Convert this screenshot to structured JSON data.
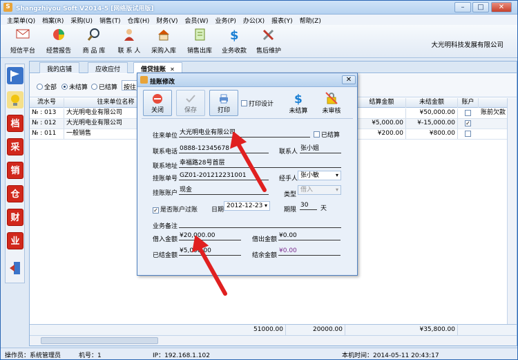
{
  "window": {
    "title": "Shangzhiyou Soft V2014-5 [网络版试用版]",
    "min": "–",
    "max": "□",
    "close": "✕"
  },
  "menu": [
    "主菜单(Q)",
    "档案(R)",
    "采购(U)",
    "销售(T)",
    "仓库(H)",
    "财务(V)",
    "会员(W)",
    "业务(P)",
    "办公(X)",
    "报表(Y)",
    "帮助(Z)"
  ],
  "toolbar": [
    {
      "label": "短信平台",
      "icon": "mail-icon"
    },
    {
      "label": "经营报告",
      "icon": "pie-chart-icon"
    },
    {
      "label": "商 品 库",
      "icon": "magnifier-icon"
    },
    {
      "label": "联 系 人",
      "icon": "person-icon"
    },
    {
      "label": "采购入库",
      "icon": "house-icon"
    },
    {
      "label": "销售出库",
      "icon": "document-icon"
    },
    {
      "label": "业务收款",
      "icon": "dollar-icon"
    },
    {
      "label": "售后维护",
      "icon": "tools-icon"
    }
  ],
  "company": "大光明科技发展有限公司",
  "sidebar": [
    {
      "icon": "flag-icon",
      "text": ""
    },
    {
      "icon": "lightbulb-icon",
      "text": ""
    },
    {
      "icon": "archive-icon",
      "text": "档"
    },
    {
      "icon": "purchase-icon",
      "text": "采"
    },
    {
      "icon": "sales-icon",
      "text": "销"
    },
    {
      "icon": "warehouse-icon",
      "text": "仓"
    },
    {
      "icon": "finance-icon",
      "text": "财"
    },
    {
      "icon": "business-icon",
      "text": "业"
    },
    {
      "icon": "exit-icon",
      "text": ""
    }
  ],
  "tabs": [
    {
      "label": "我的店铺"
    },
    {
      "label": "应收应付"
    },
    {
      "label": "借贷挂账",
      "close": "✕"
    }
  ],
  "filter": {
    "all": "全部",
    "unsettled": "未结算",
    "settled": "已结算",
    "by": "按往"
  },
  "grid": {
    "headers": [
      "流水号",
      "往来单位名称",
      "结算金额",
      "未结金额",
      "账户"
    ],
    "rows": [
      {
        "no": "№ : 013",
        "name": "大光明电业有限公司",
        "settled": "",
        "unsettled": "¥50,000.00",
        "checked": false,
        "note": "账前欠款"
      },
      {
        "no": "№ : 012",
        "name": "大光明电业有限公司",
        "settled": "¥5,000.00",
        "unsettled": "¥-15,000.00",
        "checked": true,
        "note": ""
      },
      {
        "no": "№ : 011",
        "name": "一般销售",
        "settled": "¥200.00",
        "unsettled": "¥800.00",
        "checked": false,
        "note": ""
      }
    ],
    "totals": {
      "a": "51000.00",
      "b": "20000.00",
      "c": "¥35,800.00"
    }
  },
  "dialog": {
    "title": "挂账修改",
    "buttons": {
      "close": "关闭",
      "save": "保存",
      "print": "打印",
      "print_design": "打印设计",
      "unsettled": "未结算",
      "unaudited": "未审核"
    },
    "fields": {
      "unit_label": "往来单位",
      "unit_value": "大光明电业有限公司",
      "settled_check": "已结算",
      "phone_label": "联系电话",
      "phone_value": "0888-12345678",
      "contact_label": "联系人",
      "contact_value": "张小姐",
      "address_label": "联系地址",
      "address_value": "幸福路28号首层",
      "bill_label": "挂账单号",
      "bill_value": "GZ01-201212231001",
      "handler_label": "经手人",
      "handler_value": "张小敏",
      "account_label": "挂账账户",
      "account_value": "现金",
      "type_label": "类型",
      "type_value": "借入",
      "overdue_label": "是否账户过账",
      "date_label": "日期",
      "date_value": "2012-12-23",
      "period_label": "期限",
      "period_value": "30",
      "period_unit": "天",
      "remark_label": "业务备注",
      "borrow_in_label": "借入金额",
      "borrow_in_value": "¥20,000.00",
      "borrow_out_label": "借出金额",
      "borrow_out_value": "¥0.00",
      "settled_label": "已结金额",
      "settled_value": "¥5,000.00",
      "balance_label": "结余金额",
      "balance_value": "¥0.00"
    }
  },
  "status": {
    "operator": "操作员：系统管理员",
    "machine": "机号：1",
    "ip": "IP：192.168.1.102",
    "time": "本机时间：2014-05-11 20:43:17"
  }
}
